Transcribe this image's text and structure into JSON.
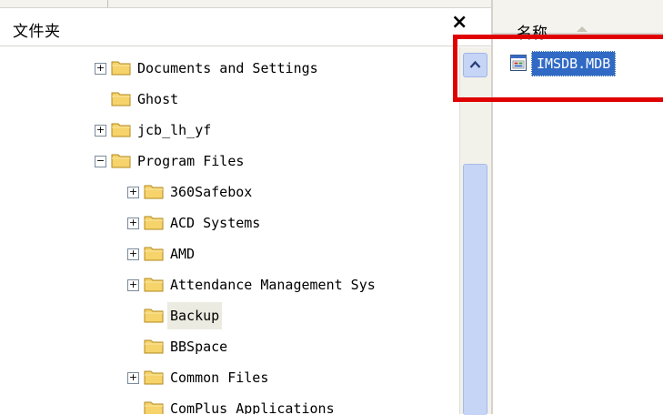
{
  "folders_pane": {
    "title": "文件夹",
    "close_symbol": "×"
  },
  "files_pane": {
    "column_name": "名称"
  },
  "tree": [
    {
      "label": "Documents and Settings",
      "expander": "+"
    },
    {
      "label": "Ghost",
      "expander": ""
    },
    {
      "label": "jcb_lh_yf",
      "expander": "+"
    },
    {
      "label": "Program Files",
      "expander": "−"
    },
    {
      "label": "360Safebox",
      "expander": "+"
    },
    {
      "label": "ACD Systems",
      "expander": "+"
    },
    {
      "label": "AMD",
      "expander": "+"
    },
    {
      "label": "Attendance Management Sys",
      "expander": "+"
    },
    {
      "label": "Backup",
      "expander": ""
    },
    {
      "label": "BBSpace",
      "expander": ""
    },
    {
      "label": "Common Files",
      "expander": "+"
    },
    {
      "label": "ComPlus Applications",
      "expander": ""
    }
  ],
  "files": [
    {
      "name": "IMSDB.MDB",
      "selected": true
    }
  ],
  "colors": {
    "selection": "#316ac5",
    "annotation": "#e00000",
    "scrollbar": "#c6d5f6"
  }
}
